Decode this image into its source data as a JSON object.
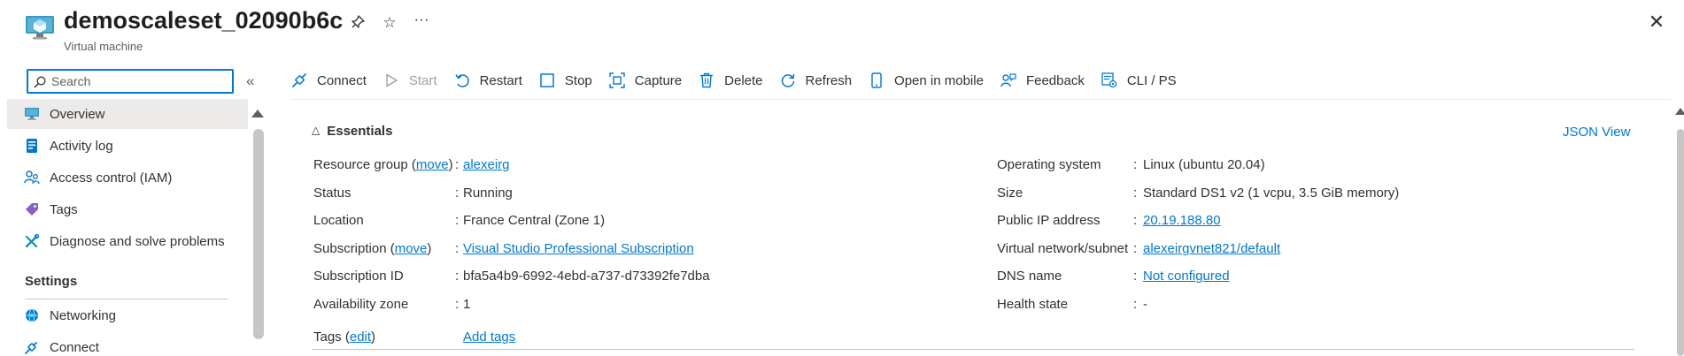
{
  "header": {
    "title": "demoscaleset_02090b6c",
    "subtitle": "Virtual machine",
    "pin_glyph": "☆",
    "more_glyph": "···",
    "close_glyph": "✕"
  },
  "sidebar": {
    "search_placeholder": "Search",
    "collapse_glyph": "«",
    "items": [
      {
        "label": "Overview",
        "icon": "overview-icon"
      },
      {
        "label": "Activity log",
        "icon": "activity-log-icon"
      },
      {
        "label": "Access control (IAM)",
        "icon": "iam-icon"
      },
      {
        "label": "Tags",
        "icon": "tag-icon"
      },
      {
        "label": "Diagnose and solve problems",
        "icon": "diagnose-icon"
      }
    ],
    "section_settings": "Settings",
    "settings_items": [
      {
        "label": "Networking",
        "icon": "networking-icon"
      },
      {
        "label": "Connect",
        "icon": "connect-icon"
      }
    ]
  },
  "toolbar": {
    "connect": "Connect",
    "start": "Start",
    "restart": "Restart",
    "stop": "Stop",
    "capture": "Capture",
    "delete": "Delete",
    "refresh": "Refresh",
    "open_in_mobile": "Open in mobile",
    "feedback": "Feedback",
    "cli_ps": "CLI / PS"
  },
  "essentials": {
    "heading": "Essentials",
    "json_view": "JSON View",
    "colon": ":",
    "left": {
      "resource_group_label": "Resource group",
      "move_link": "move",
      "resource_group_value": "alexeirg",
      "status_label": "Status",
      "status_value": "Running",
      "location_label": "Location",
      "location_value": "France Central (Zone 1)",
      "subscription_label": "Subscription",
      "subscription_value": "Visual Studio Professional Subscription",
      "subscription_id_label": "Subscription ID",
      "subscription_id_value": "bfa5a4b9-6992-4ebd-a737-d73392fe7dba",
      "availability_zone_label": "Availability zone",
      "availability_zone_value": "1",
      "tags_label": "Tags",
      "edit_link": "edit",
      "tags_value": "Add tags"
    },
    "right": {
      "os_label": "Operating system",
      "os_value": "Linux (ubuntu 20.04)",
      "size_label": "Size",
      "size_value": "Standard DS1 v2 (1 vcpu, 3.5 GiB memory)",
      "public_ip_label": "Public IP address",
      "public_ip_value": "20.19.188.80",
      "vnet_label": "Virtual network/subnet",
      "vnet_value": "alexeirgvnet821/default",
      "dns_label": "DNS name",
      "dns_value": "Not configured",
      "health_label": "Health state",
      "health_value": "-"
    }
  },
  "colors": {
    "accent": "#0078d4",
    "text": "#323130",
    "selected_bg": "#edebe9"
  }
}
